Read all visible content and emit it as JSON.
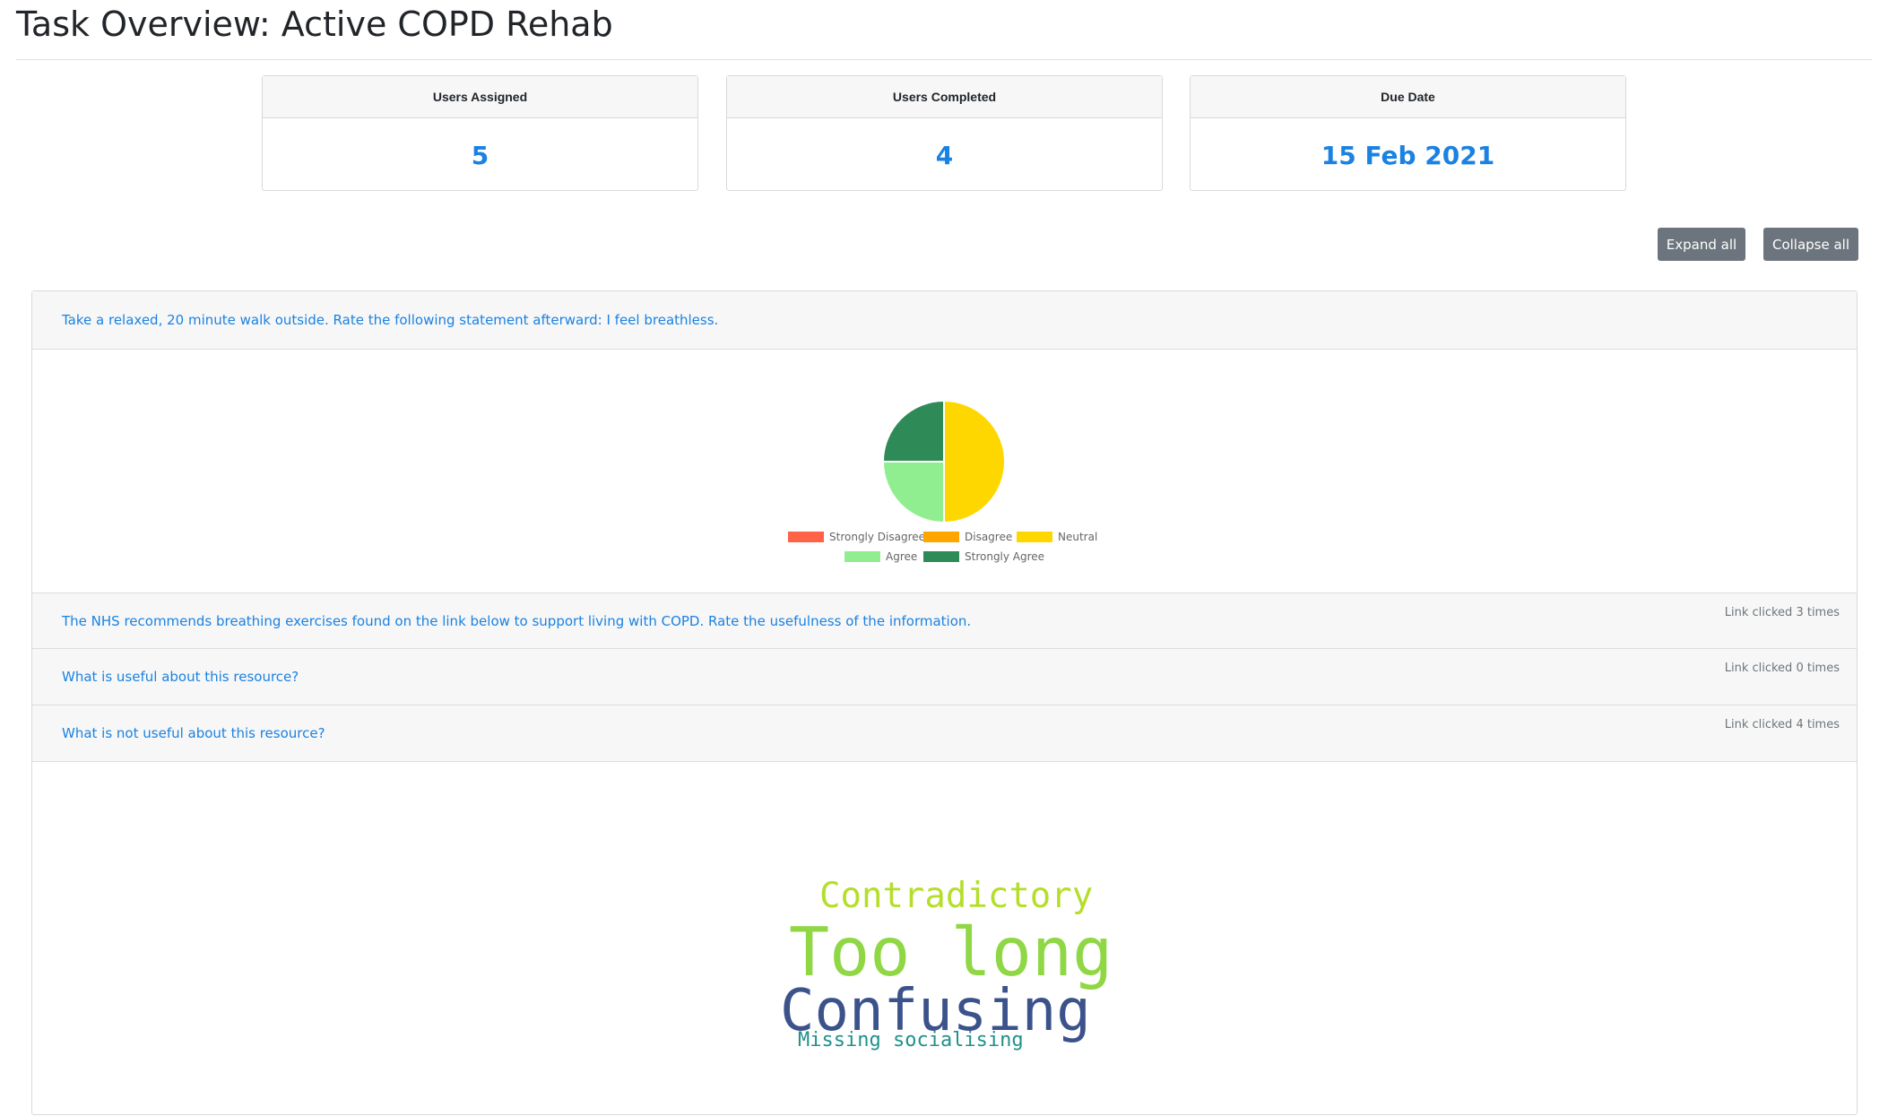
{
  "page": {
    "title": "Task Overview: Active COPD Rehab"
  },
  "stats": [
    {
      "label": "Users Assigned",
      "value": "5"
    },
    {
      "label": "Users Completed",
      "value": "4"
    },
    {
      "label": "Due Date",
      "value": "15 Feb 2021"
    }
  ],
  "actions": {
    "expand_label": "Expand all",
    "collapse_label": "Collapse all"
  },
  "questions": [
    {
      "text": "Take a relaxed, 20 minute walk outside. Rate the following statement afterward: I feel breathless.",
      "meta": ""
    },
    {
      "text": "The NHS recommends breathing exercises found on the link below to support living with COPD. Rate the usefulness of the information.",
      "meta": "Link clicked 3 times"
    },
    {
      "text": "What is useful about this resource?",
      "meta": "Link clicked 0 times"
    },
    {
      "text": "What is not useful about this resource?",
      "meta": "Link clicked 4 times"
    }
  ],
  "chart_data": {
    "type": "pie",
    "labels": [
      "Strongly Disagree",
      "Disagree",
      "Neutral",
      "Agree",
      "Strongly Agree"
    ],
    "values": [
      0,
      0,
      2,
      1,
      1
    ],
    "colors": [
      "#ff6347",
      "#ffa500",
      "#ffd700",
      "#90ee90",
      "#2e8b57"
    ],
    "legend_position": "bottom"
  },
  "word_cloud": [
    {
      "word": "Contradictory",
      "color": "#b5de2b"
    },
    {
      "word": "Too long",
      "color": "#8fd744"
    },
    {
      "word": "Confusing",
      "color": "#3b528b"
    },
    {
      "word": "Missing socialising",
      "color": "#21918c"
    }
  ]
}
